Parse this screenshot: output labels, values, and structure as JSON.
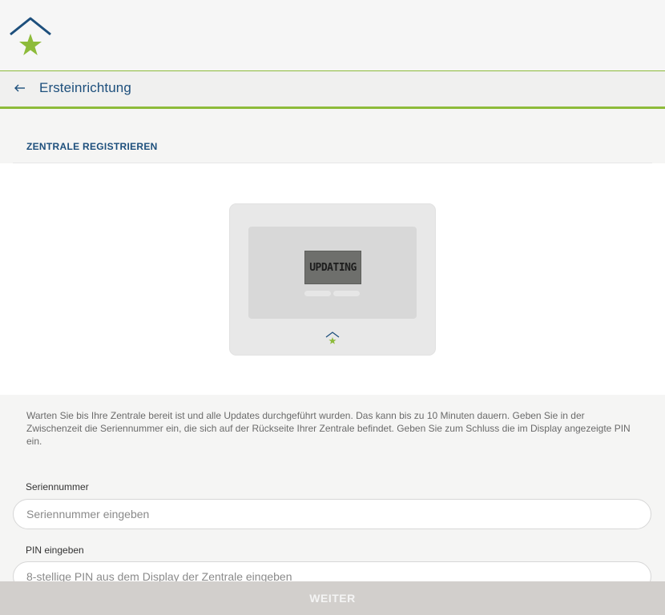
{
  "header": {
    "logo_icon": "house-star-logo"
  },
  "nav": {
    "back_icon": "arrow-left-icon",
    "title": "Ersteinrichtung"
  },
  "section": {
    "title": "ZENTRALE REGISTRIEREN"
  },
  "device": {
    "display_text": "UPDATING"
  },
  "instructions": "Warten Sie bis Ihre Zentrale bereit ist und alle Updates durchgeführt wurden. Das kann bis zu 10 Minuten dauern. Geben Sie in der Zwischenzeit die Seriennummer ein, die sich auf der Rückseite Ihrer Zentrale befindet. Geben Sie zum Schluss die im Display angezeigte PIN ein.",
  "form": {
    "serial": {
      "label": "Seriennummer",
      "placeholder": "Seriennummer eingeben",
      "value": ""
    },
    "pin": {
      "label": "PIN eingeben",
      "placeholder": "8-stellige PIN aus dem Display der Zentrale eingeben",
      "value": ""
    }
  },
  "submit_label": "WEITER",
  "colors": {
    "brand_blue": "#1d4f7c",
    "brand_green": "#8dbb3a",
    "button_disabled": "#d2cfcc"
  }
}
